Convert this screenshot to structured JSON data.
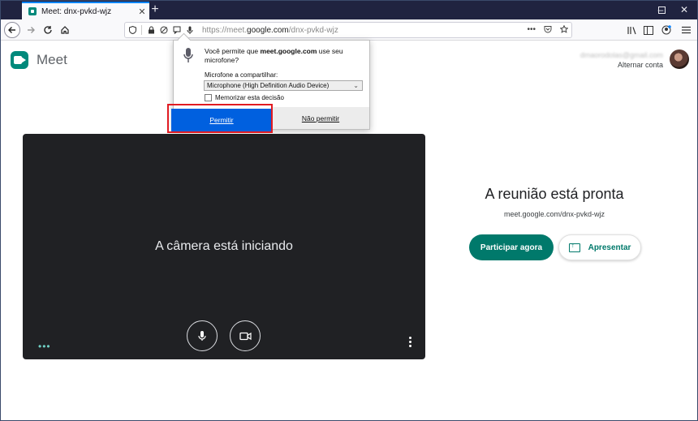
{
  "browser": {
    "tab_title": "Meet: dnx-pvkd-wjz",
    "tab_close": "✕",
    "new_tab": "+",
    "window": {
      "minimize": "–",
      "maximize": "☐",
      "close": "✕"
    },
    "url_prefix": "https://meet.",
    "url_domain": "google.com",
    "url_path": "/dnx-pvkd-wjz",
    "url_more": "•••"
  },
  "meet": {
    "logo_text": "Meet",
    "account_email": "dmaorodolas@gmail.com",
    "switch_account": "Alternar conta",
    "camera_status": "A câmera está iniciando",
    "more_dots": "•••",
    "ready_title": "A reunião está pronta",
    "meeting_url": "meet.google.com/dnx-pvkd-wjz",
    "join_label": "Participar agora",
    "present_label": "Apresentar"
  },
  "permission_popup": {
    "question_prefix": "Você permite que ",
    "question_domain": "meet.google.com",
    "question_suffix": " use seu microfone?",
    "share_label": "Microfone a compartilhar:",
    "selected_device": "Microphone (High Definition Audio Device)",
    "remember_label": "Memorizar esta decisão",
    "allow_label": "Permitir",
    "deny_label": "Não permitir"
  },
  "colors": {
    "meet_green": "#00796b",
    "allow_blue": "#0060df",
    "highlight_red": "#e11b22",
    "video_bg": "#202124"
  }
}
